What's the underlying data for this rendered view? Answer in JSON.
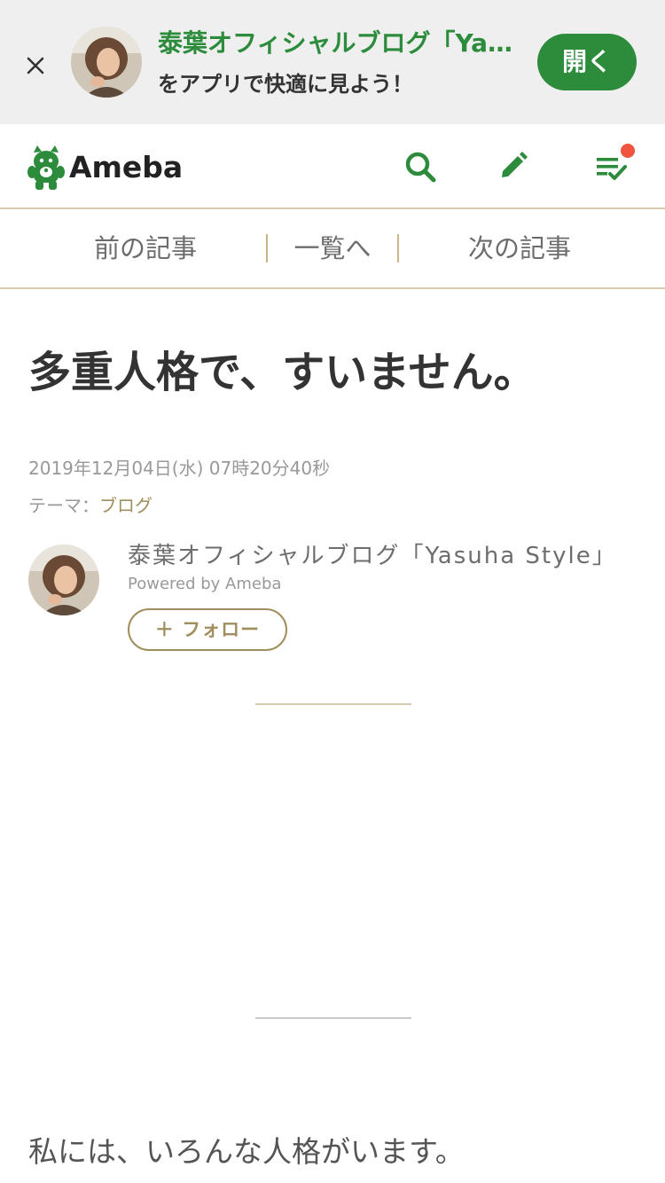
{
  "banner": {
    "title": "泰葉オフィシャルブログ「Yasuha Style」",
    "subtitle": "をアプリで快適に見よう！",
    "open_label": "開く"
  },
  "header": {
    "logo_text": "Ameba"
  },
  "article_nav": {
    "prev": "前の記事",
    "list": "一覧へ",
    "next": "次の記事"
  },
  "entry": {
    "title": "多重人格で、すいません。",
    "date": "2019年12月04日(水) 07時20分40秒",
    "theme_label": "テーマ：",
    "theme_value": "ブログ",
    "body_first_line": "私には、いろんな人格がいます。"
  },
  "author": {
    "blog_name": "泰葉オフィシャルブログ「Yasuha Style」",
    "powered_by": "Powered by Ameba",
    "follow_label": "＋ フォロー"
  },
  "colors": {
    "brand_green": "#2d8c3c",
    "gold_accent": "#a08f5c",
    "notification": "#f0533e",
    "banner_bg": "#efefef"
  },
  "icons": [
    "close-icon",
    "search-icon",
    "pencil-icon",
    "reading-list-icon",
    "ameba-logo-icon"
  ]
}
